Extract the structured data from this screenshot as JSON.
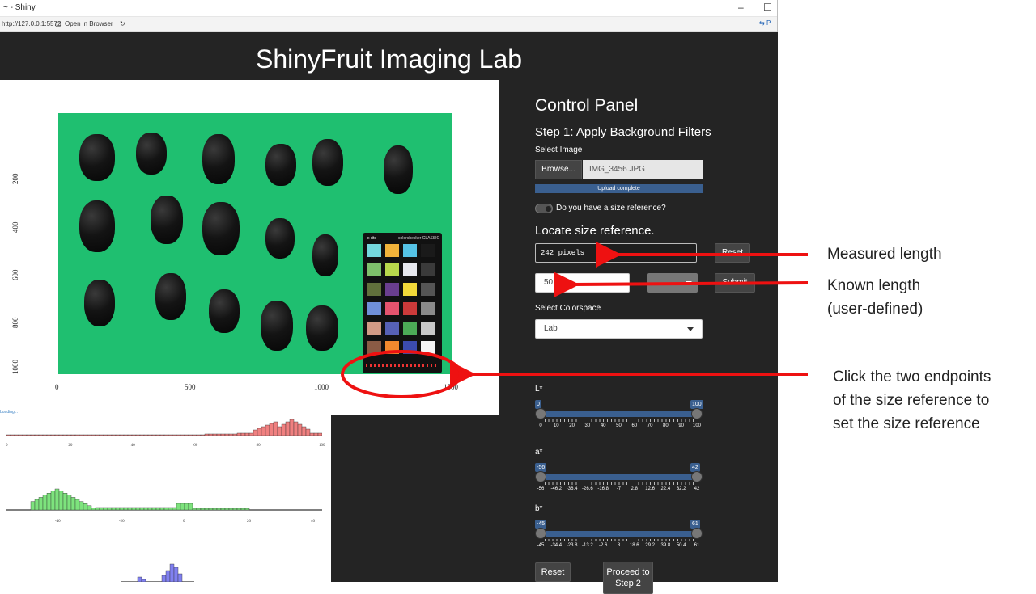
{
  "window": {
    "title": "~ - Shiny",
    "address": "http://127.0.0.1:5572",
    "open_in_browser": "Open in Browser",
    "right_fragment": "P"
  },
  "app": {
    "title": "ShinyFruit Imaging Lab"
  },
  "plot": {
    "y_ticks": [
      "200",
      "400",
      "600",
      "800",
      "1000"
    ],
    "x_ticks": [
      "0",
      "500",
      "1000",
      "1500"
    ],
    "colorchecker_brand": "x-rite",
    "colorchecker_label": "colorchecker CLASSIC"
  },
  "histograms": {
    "loading": "Loading...",
    "h1_ticks": [
      "0",
      "20",
      "40",
      "60",
      "80",
      "100"
    ],
    "h2_ticks": [
      "-40",
      "-20",
      "0",
      "20",
      "40"
    ]
  },
  "panel": {
    "title": "Control Panel",
    "step1": "Step 1: Apply Background Filters",
    "select_image_label": "Select Image",
    "browse_label": "Browse...",
    "file_name": "IMG_3456.JPG",
    "upload_status": "Upload complete",
    "size_ref_toggle_label": "Do you have a size reference?",
    "locate_title": "Locate size reference.",
    "measured_value": "242 pixels",
    "reset_top_label": "Reset",
    "known_value": "50",
    "unit_value": "",
    "submit_label": "Submit",
    "colorspace_label": "Select Colorspace",
    "colorspace_value": "Lab",
    "sliders": [
      {
        "label": "L*",
        "min": "0",
        "max": "100",
        "ticks": [
          "0",
          "10",
          "20",
          "30",
          "40",
          "50",
          "60",
          "70",
          "80",
          "90",
          "100"
        ]
      },
      {
        "label": "a*",
        "min": "-56",
        "max": "42",
        "ticks": [
          "-56",
          "-46.2",
          "-36.4",
          "-26.6",
          "-16.8",
          "-7",
          "2.8",
          "12.6",
          "22.4",
          "32.2",
          "42"
        ]
      },
      {
        "label": "b*",
        "min": "-45",
        "max": "61",
        "ticks": [
          "-45",
          "-34.4",
          "-23.8",
          "-13.2",
          "-2.6",
          "8",
          "18.6",
          "29.2",
          "39.8",
          "50.4",
          "61"
        ]
      }
    ],
    "reset_label": "Reset",
    "proceed_label": "Proceed to Step 2"
  },
  "annotations": {
    "measured_length": "Measured length",
    "known_length": "Known length\n(user-defined)",
    "click_endpoints": "Click the two endpoints\nof the size reference to\nset the size reference",
    "arrow_color": "#e11",
    "hist_colors": [
      "#f08080",
      "#7de37d",
      "#8080f0"
    ]
  }
}
